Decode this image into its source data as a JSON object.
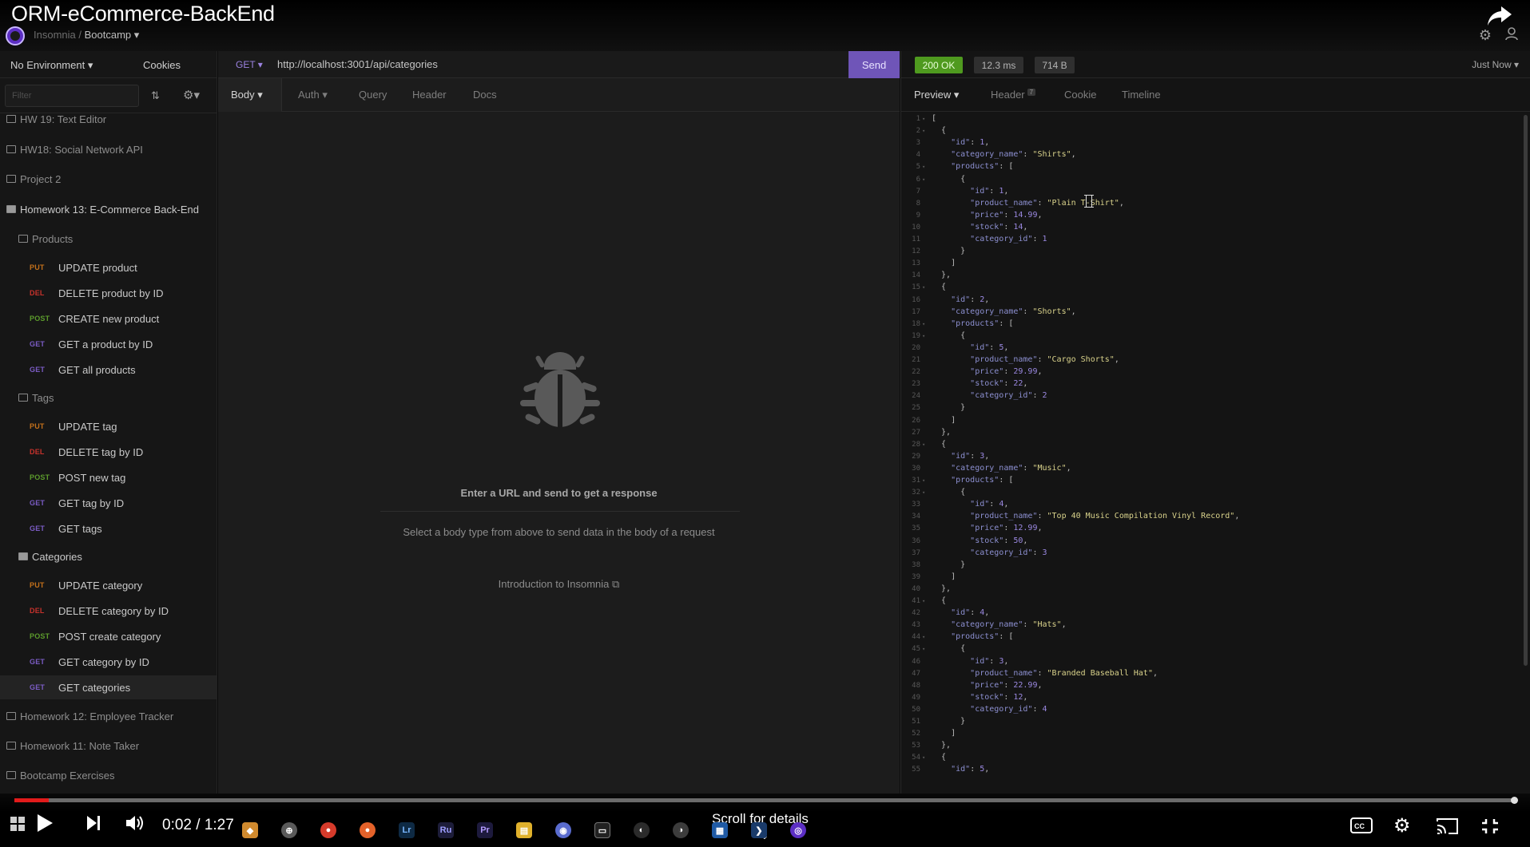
{
  "video": {
    "title": "ORM-eCommerce-BackEnd",
    "time": "0:02 / 1:27",
    "scroll_hint": "Scroll for details",
    "progress": 0.023
  },
  "app": {
    "breadcrumb_app": "Insomnia",
    "breadcrumb_sep": "/",
    "workspace": "Bootcamp"
  },
  "sidebar": {
    "environment": "No Environment",
    "cookies": "Cookies",
    "filter_placeholder": "Filter",
    "items": [
      {
        "kind": "folder",
        "label": "HW 19: Text Editor"
      },
      {
        "kind": "folder",
        "label": "HW18: Social Network API"
      },
      {
        "kind": "folder",
        "label": "Project 2"
      },
      {
        "kind": "folder-open",
        "label": "Homework 13: E-Commerce Back-End"
      },
      {
        "kind": "subfolder",
        "label": "Products"
      },
      {
        "kind": "request",
        "method": "PUT",
        "label": "UPDATE product"
      },
      {
        "kind": "request",
        "method": "DEL",
        "label": "DELETE product by ID"
      },
      {
        "kind": "request",
        "method": "POST",
        "label": "CREATE new product"
      },
      {
        "kind": "request",
        "method": "GET",
        "label": "GET a product by ID"
      },
      {
        "kind": "request",
        "method": "GET",
        "label": "GET all products"
      },
      {
        "kind": "subfolder",
        "label": "Tags"
      },
      {
        "kind": "request",
        "method": "PUT",
        "label": "UPDATE tag"
      },
      {
        "kind": "request",
        "method": "DEL",
        "label": "DELETE tag by ID"
      },
      {
        "kind": "request",
        "method": "POST",
        "label": "POST new tag"
      },
      {
        "kind": "request",
        "method": "GET",
        "label": "GET tag by ID"
      },
      {
        "kind": "request",
        "method": "GET",
        "label": "GET tags"
      },
      {
        "kind": "subfolder-open",
        "label": "Categories"
      },
      {
        "kind": "request",
        "method": "PUT",
        "label": "UPDATE category"
      },
      {
        "kind": "request",
        "method": "DEL",
        "label": "DELETE category by ID"
      },
      {
        "kind": "request",
        "method": "POST",
        "label": "POST create category"
      },
      {
        "kind": "request",
        "method": "GET",
        "label": "GET category by ID"
      },
      {
        "kind": "request",
        "method": "GET",
        "label": "GET categories",
        "active": true
      },
      {
        "kind": "folder",
        "label": "Homework 12: Employee Tracker"
      },
      {
        "kind": "folder",
        "label": "Homework 11: Note Taker"
      },
      {
        "kind": "folder",
        "label": "Bootcamp Exercises"
      }
    ]
  },
  "request": {
    "method": "GET",
    "url": "http://localhost:3001/api/categories",
    "send": "Send",
    "tabs": [
      "Body",
      "Auth",
      "Query",
      "Header",
      "Docs"
    ],
    "empty_title": "Enter a URL and send to get a response",
    "empty_hint": "Select a body type from above to send data in the body of a request",
    "intro_link": "Introduction to Insomnia"
  },
  "response": {
    "status": "200 OK",
    "time": "12.3 ms",
    "size": "714 B",
    "history": "Just Now",
    "tabs": [
      "Preview",
      "Header",
      "Cookie",
      "Timeline"
    ],
    "header_count": "7",
    "lines": [
      "[",
      "  {",
      "    \"id\": 1,",
      "    \"category_name\": \"Shirts\",",
      "    \"products\": [",
      "      {",
      "        \"id\": 1,",
      "        \"product_name\": \"Plain T-Shirt\",",
      "        \"price\": 14.99,",
      "        \"stock\": 14,",
      "        \"category_id\": 1",
      "      }",
      "    ]",
      "  },",
      "  {",
      "    \"id\": 2,",
      "    \"category_name\": \"Shorts\",",
      "    \"products\": [",
      "      {",
      "        \"id\": 5,",
      "        \"product_name\": \"Cargo Shorts\",",
      "        \"price\": 29.99,",
      "        \"stock\": 22,",
      "        \"category_id\": 2",
      "      }",
      "    ]",
      "  },",
      "  {",
      "    \"id\": 3,",
      "    \"category_name\": \"Music\",",
      "    \"products\": [",
      "      {",
      "        \"id\": 4,",
      "        \"product_name\": \"Top 40 Music Compilation Vinyl Record\",",
      "        \"price\": 12.99,",
      "        \"stock\": 50,",
      "        \"category_id\": 3",
      "      }",
      "    ]",
      "  },",
      "  {",
      "    \"id\": 4,",
      "    \"category_name\": \"Hats\",",
      "    \"products\": [",
      "      {",
      "        \"id\": 3,",
      "        \"product_name\": \"Branded Baseball Hat\",",
      "        \"price\": 22.99,",
      "        \"stock\": 12,",
      "        \"category_id\": 4",
      "      }",
      "    ]",
      "  },",
      "  {",
      "    \"id\": 5,"
    ]
  },
  "colors": {
    "accent": "#6f55b8",
    "status_ok": "#4f9a1f",
    "put": "#c3701b",
    "del": "#c7322c",
    "post": "#5c9b2c",
    "get": "#7b5cc4"
  }
}
